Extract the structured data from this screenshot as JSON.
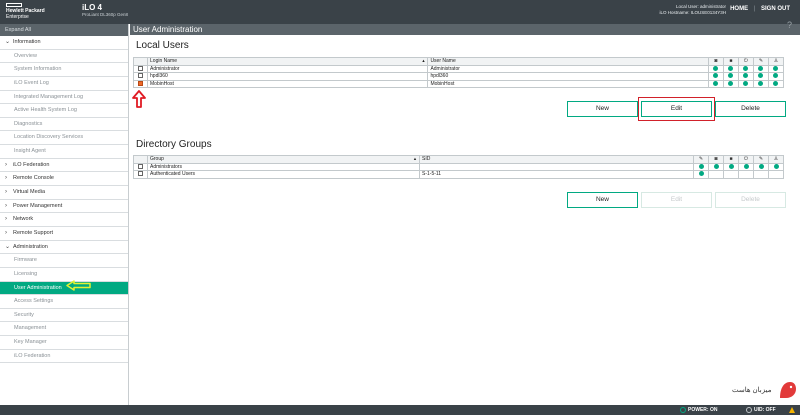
{
  "header": {
    "brand_line1": "Hewlett Packard",
    "brand_line2": "Enterprise",
    "product": "iLO 4",
    "server": "ProLiant DL360p Gen8",
    "user": "Local User: administrator",
    "hostname": "iLO Hostname: ILOUSE0134Y3H",
    "home": "HOME",
    "separator": "|",
    "signout": "SIGN OUT"
  },
  "sidebar": {
    "expand_all": "Expand All",
    "items": [
      {
        "label": "Information",
        "type": "cat",
        "chev": "⌄"
      },
      {
        "label": "Overview",
        "type": "sub"
      },
      {
        "label": "System Information",
        "type": "sub"
      },
      {
        "label": "iLO Event Log",
        "type": "sub"
      },
      {
        "label": "Integrated Management Log",
        "type": "sub"
      },
      {
        "label": "Active Health System Log",
        "type": "sub"
      },
      {
        "label": "Diagnostics",
        "type": "sub"
      },
      {
        "label": "Location Discovery Services",
        "type": "sub"
      },
      {
        "label": "Insight Agent",
        "type": "sub"
      },
      {
        "label": "iLO Federation",
        "type": "cat",
        "chev": "›"
      },
      {
        "label": "Remote Console",
        "type": "cat",
        "chev": "›"
      },
      {
        "label": "Virtual Media",
        "type": "cat",
        "chev": "›"
      },
      {
        "label": "Power Management",
        "type": "cat",
        "chev": "›"
      },
      {
        "label": "Network",
        "type": "cat",
        "chev": "›"
      },
      {
        "label": "Remote Support",
        "type": "cat",
        "chev": "›"
      },
      {
        "label": "Administration",
        "type": "cat",
        "chev": "⌄"
      },
      {
        "label": "Firmware",
        "type": "sub"
      },
      {
        "label": "Licensing",
        "type": "sub"
      },
      {
        "label": "User Administration",
        "type": "sub",
        "active": true
      },
      {
        "label": "Access Settings",
        "type": "sub"
      },
      {
        "label": "Security",
        "type": "sub"
      },
      {
        "label": "Management",
        "type": "sub"
      },
      {
        "label": "Key Manager",
        "type": "sub"
      },
      {
        "label": "iLO Federation",
        "type": "sub"
      }
    ]
  },
  "page": {
    "title": "User Administration",
    "help": "?"
  },
  "local_users": {
    "title": "Local Users",
    "col_login": "Login Name",
    "col_user": "User Name",
    "rows": [
      {
        "login": "Administrator",
        "user": "Administrator",
        "checked": false
      },
      {
        "login": "hpdl360",
        "user": "hpdl360",
        "checked": false
      },
      {
        "login": "MobinHost",
        "user": "MobinHost",
        "checked": true
      }
    ],
    "buttons": {
      "new": "New",
      "edit": "Edit",
      "delete": "Delete"
    }
  },
  "directory_groups": {
    "title": "Directory Groups",
    "col_group": "Group",
    "col_sid": "SID",
    "rows": [
      {
        "group": "Administrators",
        "sid": "",
        "perms": 6
      },
      {
        "group": "Authenticated Users",
        "sid": "S-1-5-11",
        "perms": 1
      }
    ],
    "buttons": {
      "new": "New",
      "edit": "Edit",
      "delete": "Delete"
    }
  },
  "statusbar": {
    "power": "POWER: ON",
    "uid": "UID: OFF"
  },
  "watermark": {
    "text": "میزبان هاست"
  },
  "colors": {
    "accent": "#01a982",
    "header_bg": "#3a4248",
    "highlight": "#d1212a",
    "annotation_arrow": "#e4f232"
  },
  "icons": {
    "perm_columns": [
      "monitor-icon",
      "disk-icon",
      "power-icon",
      "wrench-icon",
      "user-icon"
    ],
    "dir_perm_columns": [
      "wrench-icon",
      "monitor-icon",
      "disk-icon",
      "power-icon",
      "wrench-icon",
      "user-icon"
    ]
  }
}
